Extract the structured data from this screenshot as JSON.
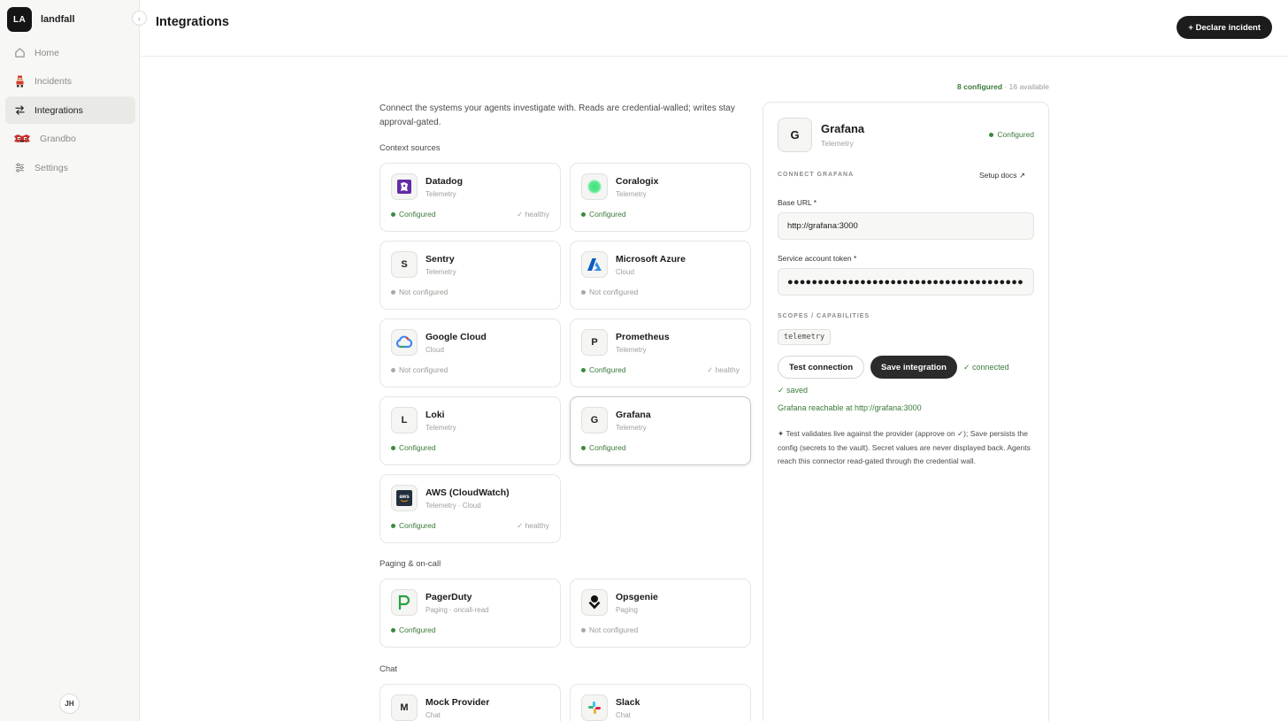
{
  "workspace": {
    "badge": "LA",
    "name": "landfall"
  },
  "sidebar": {
    "collapse_glyph": "‹",
    "items": [
      {
        "label": "Home",
        "icon": "home-icon"
      },
      {
        "label": "Incidents",
        "icon": "incidents-icon"
      },
      {
        "label": "Integrations",
        "icon": "integrations-icon",
        "active": true
      },
      {
        "label": "Grandbo",
        "icon": "grandbo-icon"
      },
      {
        "label": "Settings",
        "icon": "settings-icon"
      }
    ],
    "user_initials": "JH"
  },
  "header": {
    "title": "Integrations",
    "declare_label": "+ Declare incident"
  },
  "summary": {
    "configured": "8 configured",
    "separator": " · ",
    "available": "16 available"
  },
  "intro": "Connect the systems your agents investigate with. Reads are credential-walled; writes stay approval-gated.",
  "sections": {
    "context": "Context sources",
    "paging": "Paging & on-call",
    "chat": "Chat"
  },
  "status_labels": {
    "configured": "Configured",
    "not_configured": "Not configured",
    "healthy": "✓ healthy"
  },
  "cards": {
    "datadog": {
      "name": "Datadog",
      "category": "Telemetry"
    },
    "coralogix": {
      "name": "Coralogix",
      "category": "Telemetry"
    },
    "sentry": {
      "name": "Sentry",
      "category": "Telemetry",
      "logo_letter": "S"
    },
    "azure": {
      "name": "Microsoft Azure",
      "category": "Cloud"
    },
    "gcloud": {
      "name": "Google Cloud",
      "category": "Cloud"
    },
    "prometheus": {
      "name": "Prometheus",
      "category": "Telemetry",
      "logo_letter": "P"
    },
    "loki": {
      "name": "Loki",
      "category": "Telemetry",
      "logo_letter": "L"
    },
    "grafana": {
      "name": "Grafana",
      "category": "Telemetry",
      "logo_letter": "G"
    },
    "aws": {
      "name": "AWS (CloudWatch)",
      "category": "Telemetry · Cloud",
      "logo_text": "aws"
    },
    "pagerduty": {
      "name": "PagerDuty",
      "category": "Paging · oncall-read"
    },
    "opsgenie": {
      "name": "Opsgenie",
      "category": "Paging"
    },
    "mock": {
      "name": "Mock Provider",
      "category": "Chat",
      "logo_letter": "M"
    },
    "slack": {
      "name": "Slack",
      "category": "Chat"
    }
  },
  "panel": {
    "logo_letter": "G",
    "name": "Grafana",
    "category": "Telemetry",
    "status": "Configured",
    "connect_title": "CONNECT GRAFANA",
    "docs_label": "Setup docs ↗",
    "base_url_label": "Base URL *",
    "base_url_value": "http://grafana:3000",
    "token_label": "Service account token *",
    "token_value": "●●●●●●●●●●●●●●●●●●●●●●●●●●●●●●●●●●●●●●●●●●●●",
    "scopes_title": "SCOPES / CAPABILITIES",
    "scope": "telemetry",
    "test_label": "Test connection",
    "save_label": "Save integration",
    "connected": "✓ connected",
    "saved": "✓ saved",
    "reachable": "Grafana reachable at http://grafana:3000",
    "note": "✦ Test validates live against the provider (approve on ✓); Save persists the config (secrets to the vault). Secret values are never displayed back. Agents reach this connector read-gated through the credential wall."
  },
  "colors": {
    "accent_green": "#3a7a3a",
    "dark": "#1c1c1c",
    "sidebar_bg": "#f7f7f6"
  }
}
